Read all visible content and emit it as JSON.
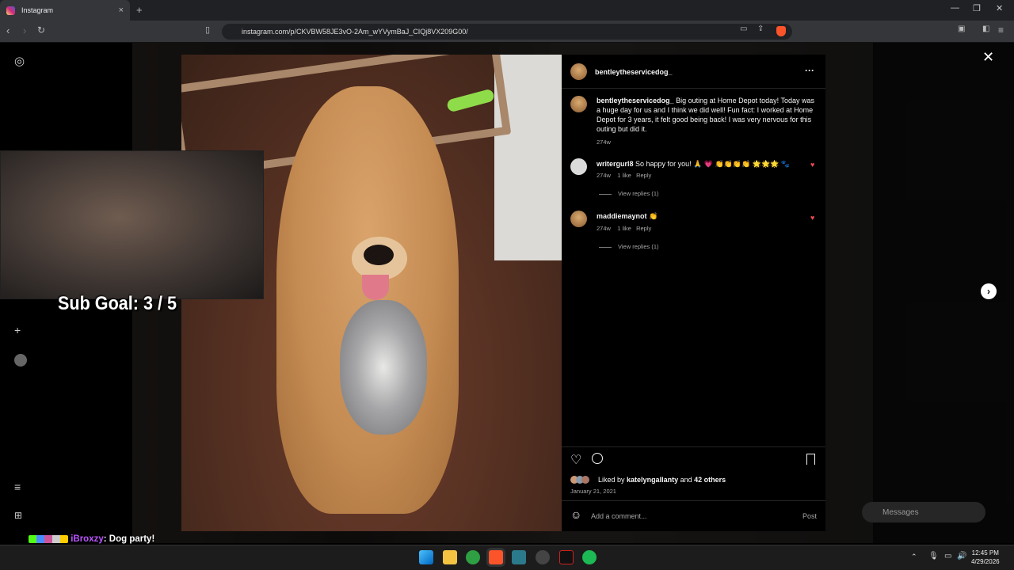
{
  "browser": {
    "tab_title": "Instagram",
    "url": "instagram.com/p/CKVBW58JE3vO-2Am_wYVymBaJ_CIQj8VX209G00/",
    "new_tab": "+",
    "tab_close": "×"
  },
  "post": {
    "author": "bentleytheservicedog_",
    "caption": "Big outing at Home Depot today! Today was a huge day for us and I think we did well! Fun fact: I worked at Home Depot for 3 years, it felt good being back! I was very nervous for this outing but did it.",
    "caption_age": "274w",
    "more": "···",
    "liked_prefix": "Liked by",
    "liked_user": "katelyngallanty",
    "liked_and": "and",
    "liked_others": "42 others",
    "date": "January 21, 2021",
    "add_comment_placeholder": "Add a comment...",
    "post_button": "Post"
  },
  "comments": [
    {
      "user": "writergurl8",
      "text": "So happy for you! 🙏 💗 👏👏👏👏 🌟🌟🌟 🐾",
      "age": "274w",
      "likes": "1 like",
      "reply": "Reply",
      "view_replies": "View replies (1)"
    },
    {
      "user": "maddiemaynot",
      "text": "👏",
      "age": "274w",
      "likes": "1 like",
      "reply": "Reply",
      "view_replies": "View replies (1)"
    }
  ],
  "overlay": {
    "sub_goal": "Sub Goal:  3 / 5",
    "chat_user": "iBroxzy",
    "chat_message": ": Dog party!"
  },
  "messages_label": "Messages",
  "taskbar": {
    "time": "12:45 PM",
    "date": "4/29/2026"
  }
}
